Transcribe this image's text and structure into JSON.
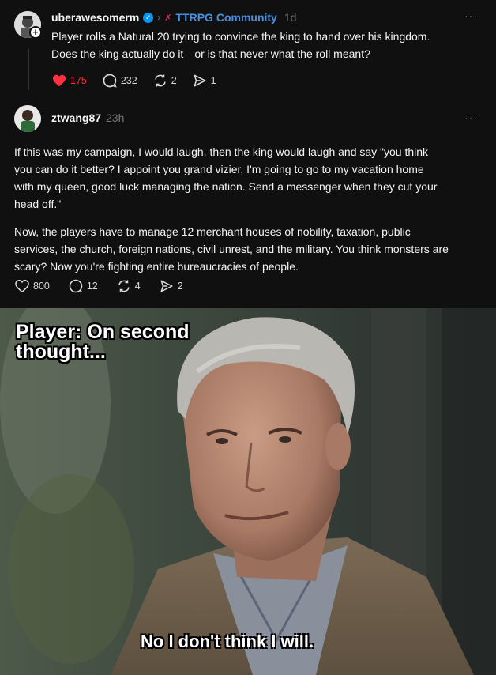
{
  "post": {
    "username": "uberawesomerm",
    "community": "TTRPG Community",
    "time": "1d",
    "text_line1": "Player rolls a Natural 20 trying to convince the king to hand over his kingdom.",
    "text_line2": "Does the king actually do it—or is that never what the roll meant?",
    "likes": "175",
    "comments": "232",
    "reposts": "2",
    "shares": "1"
  },
  "reply": {
    "username": "ztwang87",
    "time": "23h",
    "para1_lines": [
      "If this was my campaign, I would laugh, then the king would laugh and say \"you think",
      "you can do it better? I appoint you grand vizier, I'm going to go to my vacation home",
      "with my queen, good luck managing the nation. Send a messenger when they cut your",
      "head off.\""
    ],
    "para2_lines": [
      "Now, the players have to manage 12 merchant houses of nobility, taxation, public",
      "services, the church, foreign nations, civil unrest, and the military. You think monsters are",
      "scary? Now you're fighting entire bureaucracies of people."
    ],
    "likes": "800",
    "comments": "12",
    "reposts": "4",
    "shares": "2"
  },
  "meme": {
    "caption_top_line1": "Player: On second",
    "caption_top_line2": "thought...",
    "caption_bottom": "No I don't think I will."
  },
  "more_label": "···",
  "colors": {
    "background": "#101010",
    "like_active": "#ff3040",
    "verified": "#0095f6",
    "community_link": "#4a90e2"
  },
  "icons": [
    "verified-icon",
    "chevron-right-icon",
    "community-icon",
    "heart-icon",
    "comment-icon",
    "repost-icon",
    "share-icon",
    "follow-plus-icon",
    "more-icon"
  ]
}
